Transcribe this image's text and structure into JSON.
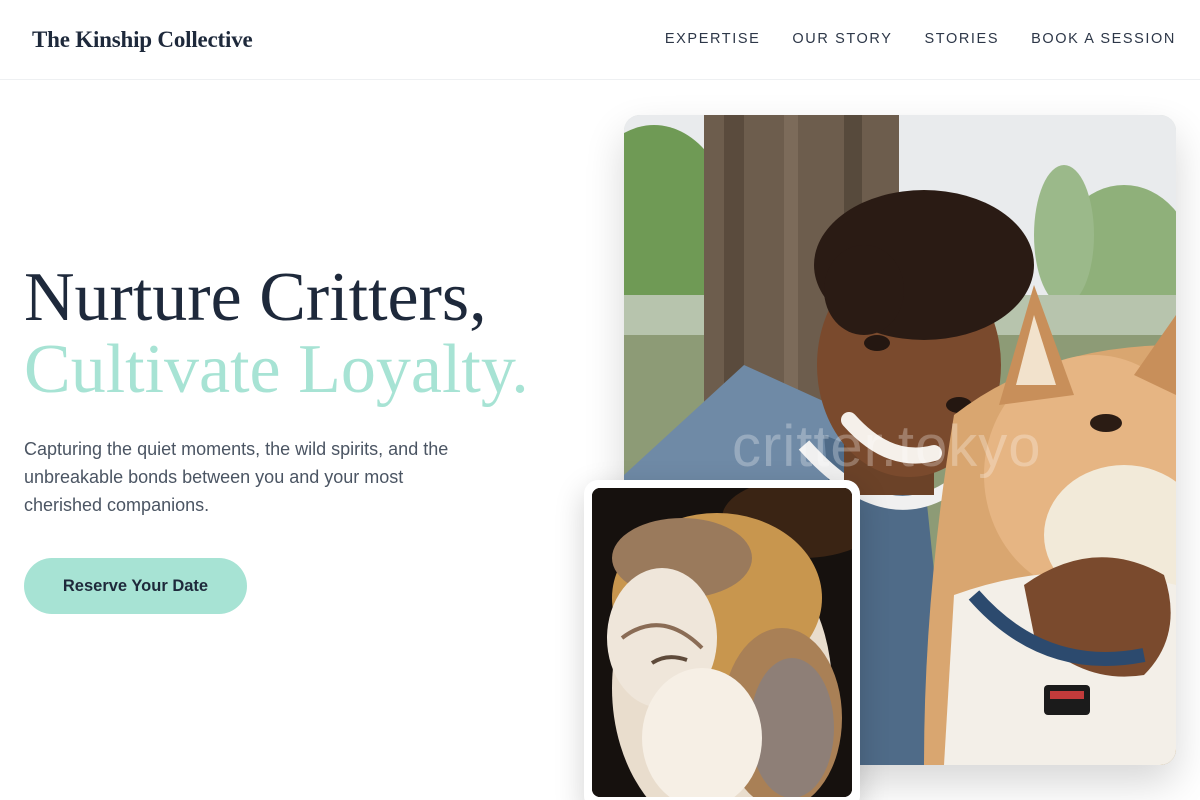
{
  "brand": {
    "name": "The Kinship Collective"
  },
  "nav": {
    "items": [
      {
        "label": "EXPERTISE"
      },
      {
        "label": "OUR STORY"
      },
      {
        "label": "STORIES"
      },
      {
        "label": "BOOK A SESSION"
      }
    ]
  },
  "hero": {
    "title_line1": "Nurture Critters,",
    "title_line2": "Cultivate Loyalty.",
    "subtitle": "Capturing the quiet moments, the wild spirits, and the unbreakable bonds between you and your most cherished companions.",
    "cta_label": "Reserve Your Date"
  },
  "photos": {
    "main_watermark": "critter.tokyo"
  },
  "colors": {
    "accent": "#a7e3d4",
    "heading": "#1e293b",
    "body_text": "#4b5563"
  }
}
